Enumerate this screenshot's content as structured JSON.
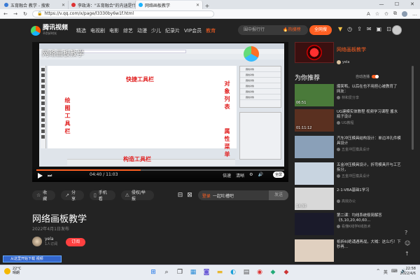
{
  "browser": {
    "tabs": [
      {
        "label": "五育融合 教学 - 搜索",
        "active": false,
        "color": "#3a7bd5"
      },
      {
        "label": "李政涛：\"五育融合\"的内涵是什么",
        "active": false,
        "color": "#d33"
      },
      {
        "label": "网络画板教学",
        "active": true,
        "color": "#19b3ff"
      }
    ],
    "new_tab": "+",
    "url": "https://v.qq.com/x/page/l3330by6w1f.html",
    "window_controls": [
      "—",
      "☐",
      "✕"
    ]
  },
  "site": {
    "logo_text": "腾讯视频",
    "logo_sub": "不负好时光",
    "nav": [
      "精选",
      "电视剧",
      "电影",
      "综艺",
      "动漫",
      "少儿",
      "纪录片",
      "VIP会员",
      "教育"
    ],
    "active_nav": "教育",
    "search_placeholder": "围中报行行",
    "hot_search": "🔥热搜榜",
    "search_button": "全网搜"
  },
  "player": {
    "overlay_title": "网络画板教学",
    "labels": {
      "quick_toolbar": "快捷工具栏",
      "drawing_toolbar": "绘图工具栏",
      "object_list": "对象列表",
      "property_menu": "属性菜单",
      "construct_toolbar": "构造工具栏"
    },
    "panel_rows": [
      "圆线对象",
      "圆线对象",
      "圆线对象",
      "圆线对象",
      "圆线对象",
      "圆线对象"
    ],
    "time": "04:40 / 11:03",
    "progress": 0.42,
    "controls": [
      "倍速",
      "清晰",
      "⚙",
      "🔊"
    ],
    "fullscreen": "全屏"
  },
  "actions": {
    "collect": "收藏",
    "share": "分享",
    "mobile": "手机看",
    "report": "侵权/举报",
    "danmu_login": "登录",
    "danmu_placeholder": "一起吐槽吧",
    "danmu_send": "发送"
  },
  "video": {
    "title": "网络画板教学",
    "date": "2022年4月1日发布",
    "uploader": "yela",
    "subscribers": "1人订阅",
    "subscribe_button": "订阅"
  },
  "channel": {
    "name": "网络画板教学",
    "user": "yela"
  },
  "recommend": {
    "header": "为你推荐",
    "autoplay_label": "自动连播",
    "items": [
      {
        "title": "爆笑鸭，以后在也不用担心被教育了 网友：",
        "duration": "06:51",
        "author": "林和爱分享",
        "thumb": "#4a7a3a"
      },
      {
        "title": "UG建模实体教程 视频学习课程 酱水瓶子设计",
        "duration": "01:11:12",
        "author": "UG教程",
        "thumb": "#5a3020"
      },
      {
        "title": "汽车冲压模具结构设计：单边冲孔件模具设计",
        "duration": "",
        "author": "五金冲压模具设计",
        "thumb": "#8aa0b8"
      },
      {
        "title": "五金冲压模具设计，折弯模具开与工艺拆分，",
        "duration": "",
        "author": "五金冲压模具设计",
        "thumb": "#c8d4e0"
      },
      {
        "title": "2-1-VBA基础1学习",
        "duration": "14:30",
        "author": "高效办公",
        "thumb": "#d8d8d8"
      },
      {
        "title": "第二课：均线系统极简解答《5,10,20,40,60…",
        "duration": "",
        "author": "看懂K线学K线技术",
        "thumb": "#1a1a2a"
      },
      {
        "title": "祇祈纠绝诵遇再战，大喊：这么巧！下秒再…",
        "duration": "",
        "author": "",
        "thumb": "#e0d0c0"
      }
    ]
  },
  "promo": "从这里开始下载 视频",
  "taskbar": {
    "temperature": "22°C",
    "weather": "晴朗",
    "time": "22:58",
    "date": "2022/4/6",
    "tray": [
      "^",
      "英",
      "⌨",
      "🔊"
    ]
  }
}
